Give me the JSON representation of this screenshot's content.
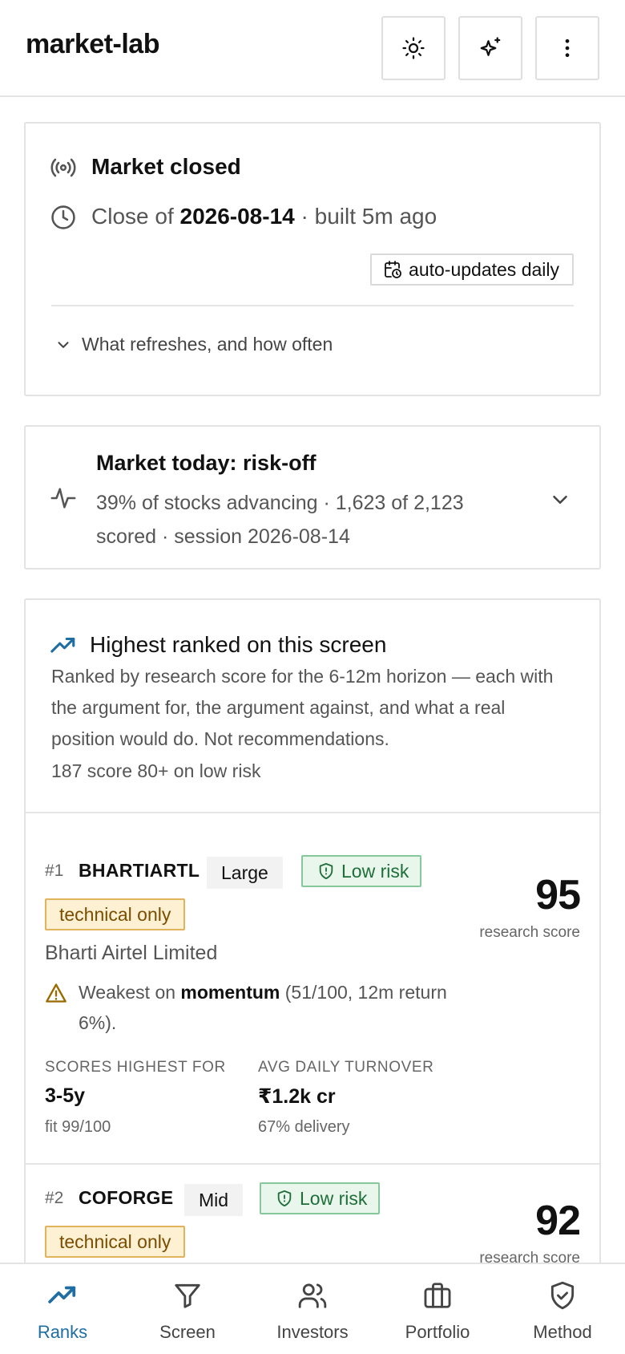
{
  "header": {
    "title": "market-lab",
    "buttons": [
      {
        "icon": "sun-icon"
      },
      {
        "icon": "sparkle-icon"
      },
      {
        "icon": "more-vertical-icon"
      }
    ]
  },
  "status": {
    "title": "Market closed",
    "close_prefix": "Close of ",
    "close_date": "2026-08-14",
    "close_suffix": " · built 5m ago",
    "badge": "auto-updates daily",
    "refresh_label": "What refreshes, and how often"
  },
  "market": {
    "title": "Market today: risk-off",
    "description": "39% of stocks advancing · 1,623 of 2,123 scored · session 2026-08-14"
  },
  "ranked": {
    "title": "Highest ranked on this screen",
    "description": "Ranked by research score for the 6-12m horizon — each with the argument for, the argument against, and what a real position would do. Not recommendations.",
    "count_text": "187 score 80+ on low risk",
    "stocks": [
      {
        "rank": "#1",
        "ticker": "BHARTIARTL",
        "cap": "Large",
        "risk": "Low risk",
        "tag": "technical only",
        "score": "95",
        "score_label": "research score",
        "company": "Bharti Airtel Limited",
        "weak_prefix": "Weakest on ",
        "weak_factor": "momentum",
        "weak_suffix": " (51/100, 12m return 6%).",
        "stat1_label": "SCORES HIGHEST FOR",
        "stat1_value": "3-5y",
        "stat1_sub": "fit 99/100",
        "stat2_label": "AVG DAILY TURNOVER",
        "stat2_value": "₹1.2k cr",
        "stat2_sub": "67% delivery"
      },
      {
        "rank": "#2",
        "ticker": "COFORGE",
        "cap": "Mid",
        "risk": "Low risk",
        "tag": "technical only",
        "score": "92",
        "score_label": "research score"
      }
    ]
  },
  "nav": {
    "items": [
      {
        "label": "Ranks",
        "icon": "trending-up-icon",
        "active": true
      },
      {
        "label": "Screen",
        "icon": "filter-icon"
      },
      {
        "label": "Investors",
        "icon": "users-icon"
      },
      {
        "label": "Portfolio",
        "icon": "briefcase-icon"
      },
      {
        "label": "Method",
        "icon": "shield-check-icon"
      }
    ]
  },
  "colors": {
    "accent": "#1f6ea3",
    "low_risk_bg": "#e8f6ec",
    "low_risk_text": "#1f6e3a",
    "tech_bg": "#fdf0d3",
    "tech_text": "#7a4e00"
  }
}
